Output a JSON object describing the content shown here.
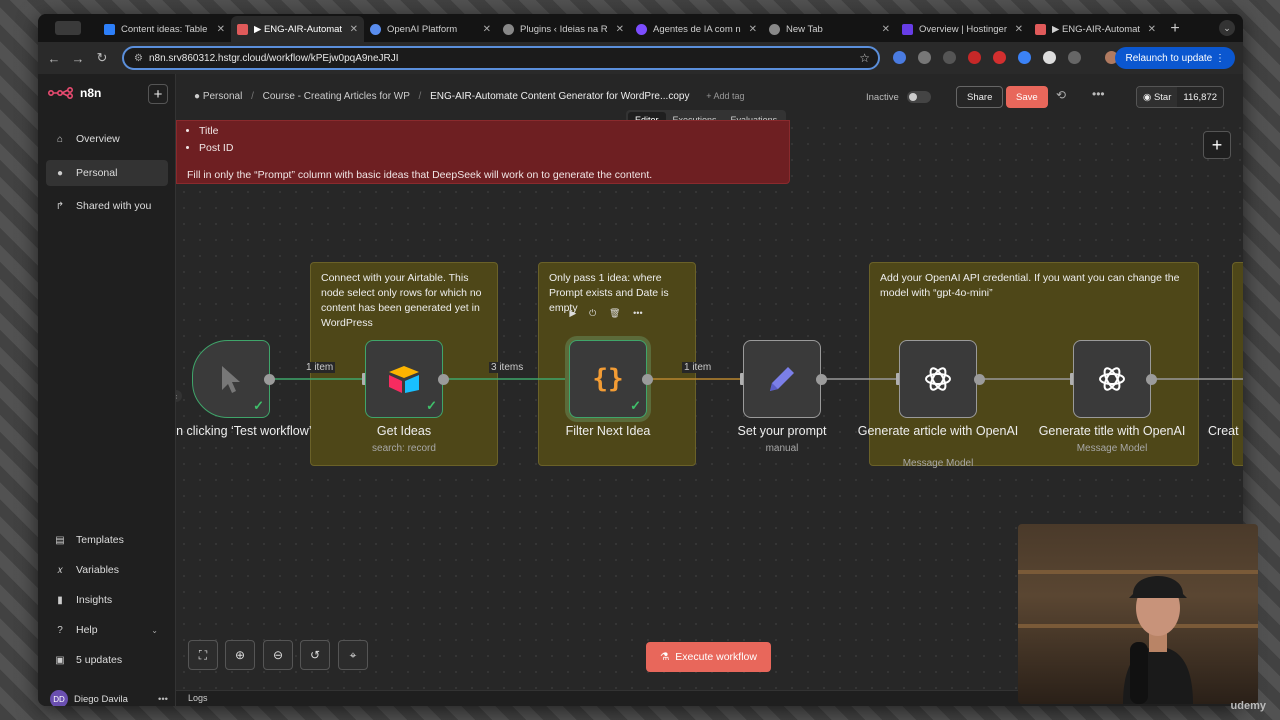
{
  "browser": {
    "tabs": [
      {
        "title": "Content ideas: Table",
        "color": "#2d7ff9",
        "active": false
      },
      {
        "title": "▶ ENG-AIR-Automat",
        "color": "#e05a5a",
        "active": true
      },
      {
        "title": "OpenAI Platform",
        "color": "#5a8dee",
        "active": false
      },
      {
        "title": "Plugins ‹ Ideias na R",
        "color": "#888888",
        "active": false
      },
      {
        "title": "Agentes de IA com n",
        "color": "#7c4dff",
        "active": false
      },
      {
        "title": "New Tab",
        "color": "#888888",
        "active": false
      },
      {
        "title": "Overview | Hostinger",
        "color": "#673de6",
        "active": false
      },
      {
        "title": "▶ ENG-AIR-Automat",
        "color": "#e05a5a",
        "active": false
      }
    ],
    "url": "n8n.srv860312.hstgr.cloud/workflow/kPEjw0pqA9neJRJI",
    "relaunch_label": "Relaunch to update"
  },
  "sidebar": {
    "brand": "n8n",
    "items": [
      {
        "label": "Overview",
        "icon": "home-icon"
      },
      {
        "label": "Personal",
        "icon": "user-icon"
      },
      {
        "label": "Shared with you",
        "icon": "share-icon"
      }
    ],
    "bottom_items": [
      {
        "label": "Templates",
        "icon": "templates-icon"
      },
      {
        "label": "Variables",
        "icon": "variables-icon"
      },
      {
        "label": "Insights",
        "icon": "insights-icon"
      },
      {
        "label": "Help",
        "icon": "help-icon"
      },
      {
        "label": "5 updates",
        "icon": "gift-icon"
      }
    ],
    "user": {
      "initials": "DD",
      "name": "Diego Davila"
    }
  },
  "header": {
    "breadcrumb": [
      "Personal",
      "Course - Creating Articles for WP"
    ],
    "workflow_name": "ENG-AIR-Automate Content Generator for WordPre...copy",
    "add_tag": "+ Add tag",
    "status": "Inactive",
    "share": "Share",
    "save": "Save",
    "github_star": "Star",
    "github_count": "116,872",
    "modes": [
      "Editor",
      "Executions",
      "Evaluations"
    ],
    "active_mode": "Editor"
  },
  "canvas": {
    "red_note": {
      "bullets": [
        "Title",
        "Post ID"
      ],
      "text": "Fill in only the “Prompt” column with basic ideas that DeepSeek will work on to generate the content."
    },
    "notes": [
      "Connect with your Airtable. This node select only rows for which no content has been generated yet in WordPress",
      "Only pass 1 idea: where Prompt exists and Date is empty",
      "Add your OpenAI API credential. If you want you can change the model with “gpt-4o-mini”"
    ],
    "nodes": [
      {
        "label": "When clicking ‘Test workflow’",
        "sub": ""
      },
      {
        "label": "Get Ideas",
        "sub": "search: record"
      },
      {
        "label": "Filter Next Idea",
        "sub": ""
      },
      {
        "label": "Set your prompt",
        "sub": "manual"
      },
      {
        "label": "Generate article with OpenAI",
        "sub": "Message Model"
      },
      {
        "label": "Generate title with OpenAI",
        "sub": "Message Model"
      },
      {
        "label": "Creat",
        "sub": ""
      }
    ],
    "edges": [
      "1 item",
      "3 items",
      "1 item"
    ],
    "execute_label": "Execute workflow",
    "logs_label": "Logs"
  },
  "overlay": {
    "watermark": "udemy"
  }
}
